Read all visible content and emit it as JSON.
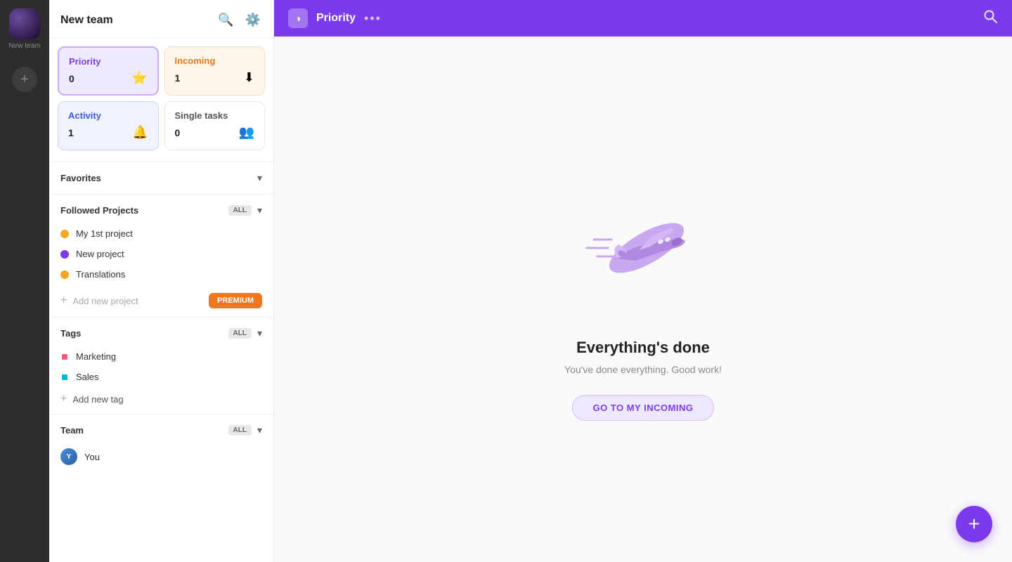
{
  "leftRail": {
    "teamName": "New team",
    "addLabel": "+"
  },
  "sidebar": {
    "title": "New team",
    "cards": [
      {
        "id": "priority",
        "label": "Priority",
        "count": "0",
        "icon": "⭐",
        "type": "priority"
      },
      {
        "id": "incoming",
        "label": "Incoming",
        "count": "1",
        "icon": "⬇️",
        "type": "incoming"
      },
      {
        "id": "activity",
        "label": "Activity",
        "count": "1",
        "icon": "🔔",
        "type": "activity"
      },
      {
        "id": "single",
        "label": "Single tasks",
        "count": "0",
        "icon": "👥",
        "type": "single"
      }
    ],
    "favorites": {
      "label": "Favorites",
      "chevron": "▾"
    },
    "followedProjects": {
      "label": "Followed Projects",
      "allBadge": "ALL",
      "chevron": "▾",
      "projects": [
        {
          "name": "My 1st project",
          "color": "#f5a623"
        },
        {
          "name": "New project",
          "color": "#7c3aed"
        },
        {
          "name": "Translations",
          "color": "#f5a623"
        }
      ],
      "addLabel": "Add new project",
      "premiumLabel": "PREMIUM"
    },
    "tags": {
      "label": "Tags",
      "allBadge": "ALL",
      "chevron": "▾",
      "items": [
        {
          "name": "Marketing",
          "color": "#e85d75"
        },
        {
          "name": "Sales",
          "color": "#00b5d8"
        }
      ],
      "addLabel": "Add new tag"
    },
    "team": {
      "label": "Team",
      "allBadge": "ALL",
      "chevron": "▾",
      "members": [
        {
          "name": "You",
          "avatarColor": "#4a90d9"
        }
      ]
    }
  },
  "topbar": {
    "logoIcon": "◑",
    "title": "Priority",
    "dotsLabel": "•••",
    "searchIcon": "⌕"
  },
  "main": {
    "emptyTitle": "Everything's done",
    "emptySubtitle": "You've done everything. Good work!",
    "goIncomingLabel": "GO TO MY INCOMING"
  },
  "fab": {
    "label": "+"
  }
}
